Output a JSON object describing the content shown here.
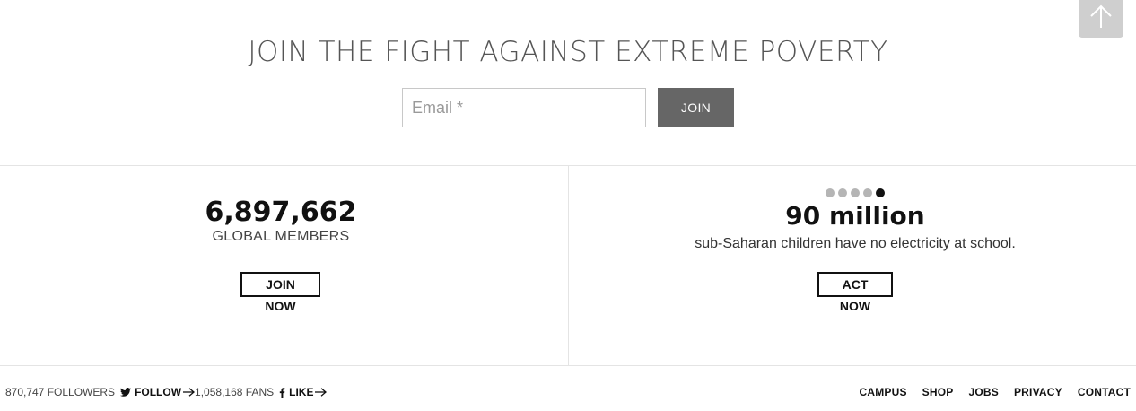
{
  "back_to_top": {
    "icon": "arrow-up-icon"
  },
  "signup": {
    "title": "JOIN THE FIGHT AGAINST EXTREME POVERTY",
    "email_placeholder": "Email *",
    "email_value": "",
    "join_label": "JOIN"
  },
  "members": {
    "count": "6,897,662",
    "label": "GLOBAL MEMBERS",
    "button_label": "JOIN NOW"
  },
  "fact": {
    "carousel_dots": 5,
    "active_dot": 5,
    "stat": "90 million",
    "text": "sub-Saharan children have no electricity at school.",
    "button_label": "ACT NOW"
  },
  "footer": {
    "twitter": {
      "count": "870,747 FOLLOWERS",
      "label": "FOLLOW",
      "icon": "twitter-icon"
    },
    "facebook": {
      "count": "1,058,168 FANS",
      "label": "LIKE",
      "icon": "facebook-icon"
    },
    "nav": [
      "CAMPUS",
      "SHOP",
      "JOBS",
      "PRIVACY",
      "CONTACT"
    ]
  },
  "colors": {
    "join_button_bg": "#666666",
    "back_to_top_bg": "#cfcfcf",
    "active_dot": "#111111",
    "inactive_dot": "#b5b5b5"
  }
}
